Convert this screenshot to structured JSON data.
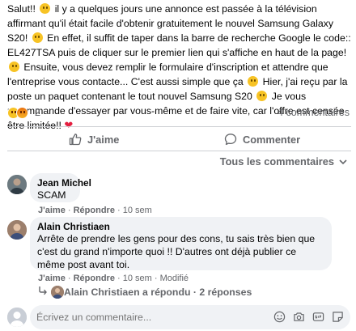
{
  "post": {
    "text_1": "Salut!! ",
    "text_2": " il y a quelques jours une  annonce est passée à la  télévision affirmant qu'il était facile d'obtenir gratuitement le nouvel Samsung Galaxy S20! ",
    "text_3": " En effet, il suffit de taper dans la barre de recherche Google le code:: EL427TSA puis de cliquer  sur le premier lien qui s'affiche en haut de la page! ",
    "text_4": "  Ensuite, vous devez remplir le formulaire d'inscription et attendre que l'entreprise vous contacte...  C'est aussi simple que ça ",
    "text_5": " Hier, j'ai reçu par la poste un paquet contenant le tout nouvel Samsung S20 ",
    "text_6": " Je vous recommande d'essayer par vous-même et de faire vite, car l'offre est censée être limitée!! ",
    "heart": "❤"
  },
  "reactions": {
    "count": "2",
    "comments": "4 commentaires"
  },
  "actions": {
    "like": "J'aime",
    "comment": "Commenter"
  },
  "sort": {
    "label": "Tous les commentaires"
  },
  "comments": [
    {
      "author": "Jean Michel",
      "text": "SCAM",
      "like": "J'aime",
      "reply": "Répondre",
      "time": "10 sem"
    },
    {
      "author": "Alain Christiaen",
      "text": "Arrête de prendre les gens pour des cons, tu sais très bien que c'est du grand n'importe quoi !! D'autres ont déjà publier ce même post avant toi.",
      "like": "J'aime",
      "reply": "Répondre",
      "time": "10 sem",
      "edited": "Modifié"
    }
  ],
  "replies": {
    "text": "Alain Christiaen a répondu · 2 réponses"
  },
  "composer": {
    "placeholder": "Écrivez un commentaire..."
  },
  "colors": {
    "text": "#050505",
    "secondary": "#65676b",
    "bubble": "#f0f2f5",
    "heart": "#e41e3f"
  },
  "icons": [
    "haha-reaction-icon",
    "angry-reaction-icon",
    "like-thumb-icon",
    "comment-icon",
    "chevron-down-icon",
    "reply-arrow-icon",
    "emoji-icon",
    "camera-icon",
    "gif-icon",
    "sticker-icon"
  ]
}
